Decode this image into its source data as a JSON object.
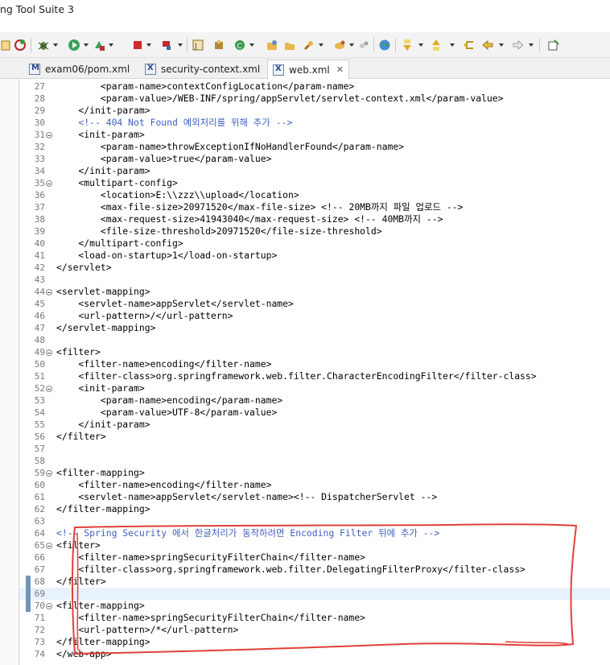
{
  "window": {
    "title": "ng Tool Suite 3"
  },
  "toolbar": {
    "icons": [
      "new-icon",
      "debug-icon",
      "run-icon",
      "external-tools-icon",
      "stop-icon",
      "server-icon",
      "new-java-project-icon",
      "new-package-icon",
      "new-class-icon",
      "open-type-icon",
      "open-task-icon",
      "search-icon",
      "open-perspective-icon",
      "globe-icon",
      "next-annotation-icon",
      "previous-annotation-icon",
      "last-edit-icon",
      "back-icon",
      "forward-icon",
      "pin-editor-icon"
    ]
  },
  "tabs": [
    {
      "label": "exam06/pom.xml",
      "icon": "M",
      "active": false
    },
    {
      "label": "security-context.xml",
      "icon": "X",
      "active": false
    },
    {
      "label": "web.xml",
      "icon": "X",
      "active": true,
      "close": "✕"
    }
  ],
  "editor": {
    "lines": [
      {
        "n": "27",
        "text": "        <param-name>contextConfigLocation</param-name>"
      },
      {
        "n": "28",
        "text": "        <param-value>/WEB-INF/spring/appServlet/servlet-context.xml</param-value>"
      },
      {
        "n": "29",
        "text": "    </init-param>"
      },
      {
        "n": "30",
        "text": "    <!-- 404 Not Found 예외처리를 위해 추가 -->"
      },
      {
        "n": "31",
        "text": "    <init-param>"
      },
      {
        "n": "32",
        "text": "        <param-name>throwExceptionIfNoHandlerFound</param-name>"
      },
      {
        "n": "33",
        "text": "        <param-value>true</param-value>"
      },
      {
        "n": "34",
        "text": "    </init-param>"
      },
      {
        "n": "35",
        "text": "    <multipart-config>"
      },
      {
        "n": "36",
        "text": "        <location>E:\\\\zzz\\\\upload</location>"
      },
      {
        "n": "37",
        "text": "        <max-file-size>20971520</max-file-size> <!-- 20MB까지 파일 업로드 -->"
      },
      {
        "n": "38",
        "text": "        <max-request-size>41943040</max-request-size> <!-- 40MB까지 -->"
      },
      {
        "n": "39",
        "text": "        <file-size-threshold>20971520</file-size-threshold>"
      },
      {
        "n": "40",
        "text": "    </multipart-config>"
      },
      {
        "n": "41",
        "text": "    <load-on-startup>1</load-on-startup>"
      },
      {
        "n": "42",
        "text": "</servlet>"
      },
      {
        "n": "43",
        "text": ""
      },
      {
        "n": "44",
        "text": "<servlet-mapping>"
      },
      {
        "n": "45",
        "text": "    <servlet-name>appServlet</servlet-name>"
      },
      {
        "n": "46",
        "text": "    <url-pattern>/</url-pattern>"
      },
      {
        "n": "47",
        "text": "</servlet-mapping>"
      },
      {
        "n": "48",
        "text": ""
      },
      {
        "n": "49",
        "text": "<filter>"
      },
      {
        "n": "50",
        "text": "    <filter-name>encoding</filter-name>"
      },
      {
        "n": "51",
        "text": "    <filter-class>org.springframework.web.filter.CharacterEncodingFilter</filter-class>"
      },
      {
        "n": "52",
        "text": "    <init-param>"
      },
      {
        "n": "53",
        "text": "        <param-name>encoding</param-name>"
      },
      {
        "n": "54",
        "text": "        <param-value>UTF-8</param-value>"
      },
      {
        "n": "55",
        "text": "    </init-param>"
      },
      {
        "n": "56",
        "text": "</filter>"
      },
      {
        "n": "57",
        "text": ""
      },
      {
        "n": "58",
        "text": ""
      },
      {
        "n": "59",
        "text": "<filter-mapping>"
      },
      {
        "n": "60",
        "text": "    <filter-name>encoding</filter-name>"
      },
      {
        "n": "61",
        "text": "    <servlet-name>appServlet</servlet-name><!-- DispatcherServlet -->"
      },
      {
        "n": "62",
        "text": "</filter-mapping>"
      },
      {
        "n": "63",
        "text": ""
      },
      {
        "n": "64",
        "text": "<!-- Spring Security 에서 한글처리가 동작하려면 Encoding Filter 뒤에 추가 -->"
      },
      {
        "n": "65",
        "text": "<filter>"
      },
      {
        "n": "66",
        "text": "    <filter-name>springSecurityFilterChain</filter-name>"
      },
      {
        "n": "67",
        "text": "    <filter-class>org.springframework.web.filter.DelegatingFilterProxy</filter-class>"
      },
      {
        "n": "68",
        "text": "</filter>"
      },
      {
        "n": "69",
        "text": ""
      },
      {
        "n": "70",
        "text": "<filter-mapping>"
      },
      {
        "n": "71",
        "text": "    <filter-name>springSecurityFilterChain</filter-name>"
      },
      {
        "n": "72",
        "text": "    <url-pattern>/*</url-pattern>"
      },
      {
        "n": "73",
        "text": "</filter-mapping>"
      },
      {
        "n": "74",
        "text": "</web-app>"
      }
    ]
  },
  "annotation": {
    "color": "#e0403a"
  }
}
